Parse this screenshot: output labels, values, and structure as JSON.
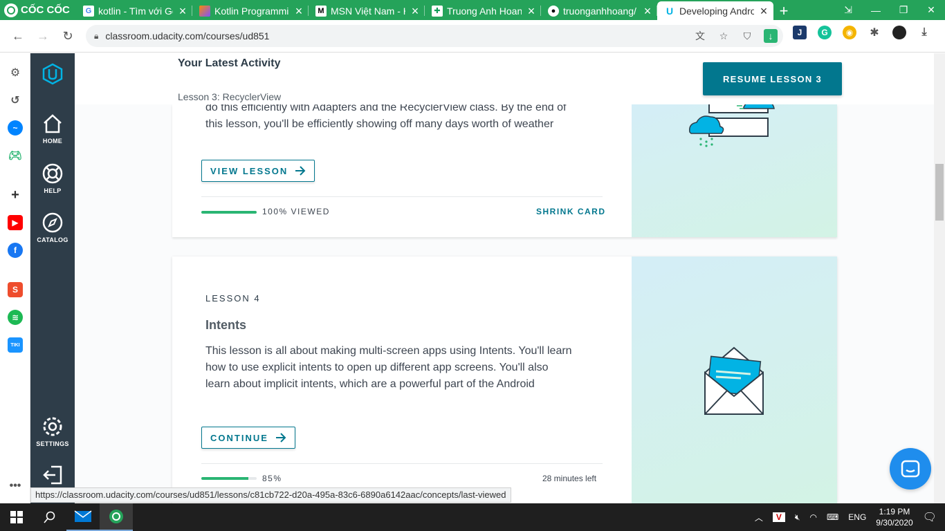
{
  "browser": {
    "brand": "CỐC CỐC",
    "tabs": [
      {
        "title": "kotlin - Tìm với Go",
        "icon": "google-icon",
        "active": false
      },
      {
        "title": "Kotlin Programmin",
        "icon": "kotlin-icon",
        "active": false
      },
      {
        "title": "MSN Việt Nam - H",
        "icon": "msn-icon",
        "active": false
      },
      {
        "title": "Truong Anh Hoang",
        "icon": "sheets-icon",
        "active": false
      },
      {
        "title": "truonganhhoang/",
        "icon": "github-icon",
        "active": false
      },
      {
        "title": "Developing Andro",
        "icon": "udacity-icon",
        "active": true
      }
    ],
    "new_tab": "+",
    "url": "classroom.udacity.com/courses/ud851",
    "status_url": "https://classroom.udacity.com/courses/ud851/lessons/c81cb722-d20a-495a-83c6-6890a6142aac/concepts/last-viewed"
  },
  "udacity_nav": {
    "items": [
      {
        "label": "HOME",
        "icon": "home-icon"
      },
      {
        "label": "HELP",
        "icon": "help-icon"
      },
      {
        "label": "CATALOG",
        "icon": "compass-icon"
      },
      {
        "label": "SETTINGS",
        "icon": "gear-icon"
      }
    ]
  },
  "sticky": {
    "title": "Your Latest Activity",
    "subtitle": "Lesson 3: RecyclerView",
    "resume_label": "RESUME LESSON 3"
  },
  "lesson3": {
    "desc_partial": "do this efficiently with Adapters and the RecyclerView class. By the end of",
    "desc_line2": "this lesson, you'll be efficiently showing off many days worth of weather",
    "button": "VIEW LESSON",
    "progress": 1.0,
    "progress_label": "100% VIEWED",
    "shrink": "SHRINK CARD"
  },
  "lesson4": {
    "number": "LESSON 4",
    "title": "Intents",
    "desc": [
      "This lesson is all about making multi-screen apps using Intents. You'll learn",
      "how to use explicit intents to open up different app screens. You'll also",
      "learn about implicit intents, which are a powerful part of the Android"
    ],
    "button": "CONTINUE",
    "progress": 0.85,
    "progress_label": "85%",
    "time_left": "28 minutes left"
  },
  "taskbar": {
    "lang": "ENG",
    "time": "1:19 PM",
    "date": "9/30/2020"
  },
  "colors": {
    "accent": "#02778e",
    "nav": "#2e3d49",
    "progress": "#2ab573",
    "browser_green": "#25a35a"
  }
}
